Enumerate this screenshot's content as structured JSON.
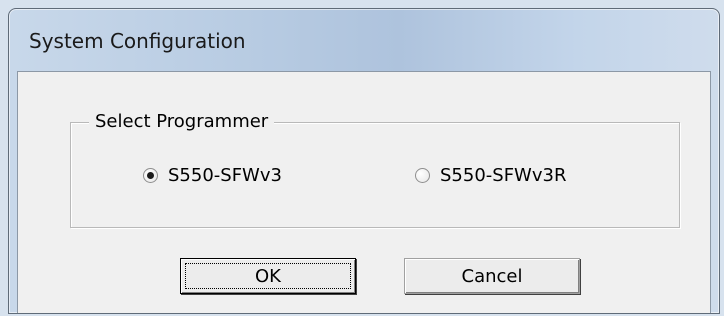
{
  "window": {
    "title": "System Configuration"
  },
  "programmer_group": {
    "label": "Select Programmer",
    "options": [
      {
        "label": "S550-SFWv3",
        "checked": true
      },
      {
        "label": "S550-SFWv3R",
        "checked": false
      }
    ]
  },
  "buttons": {
    "ok_label": "OK",
    "cancel_label": "Cancel"
  }
}
